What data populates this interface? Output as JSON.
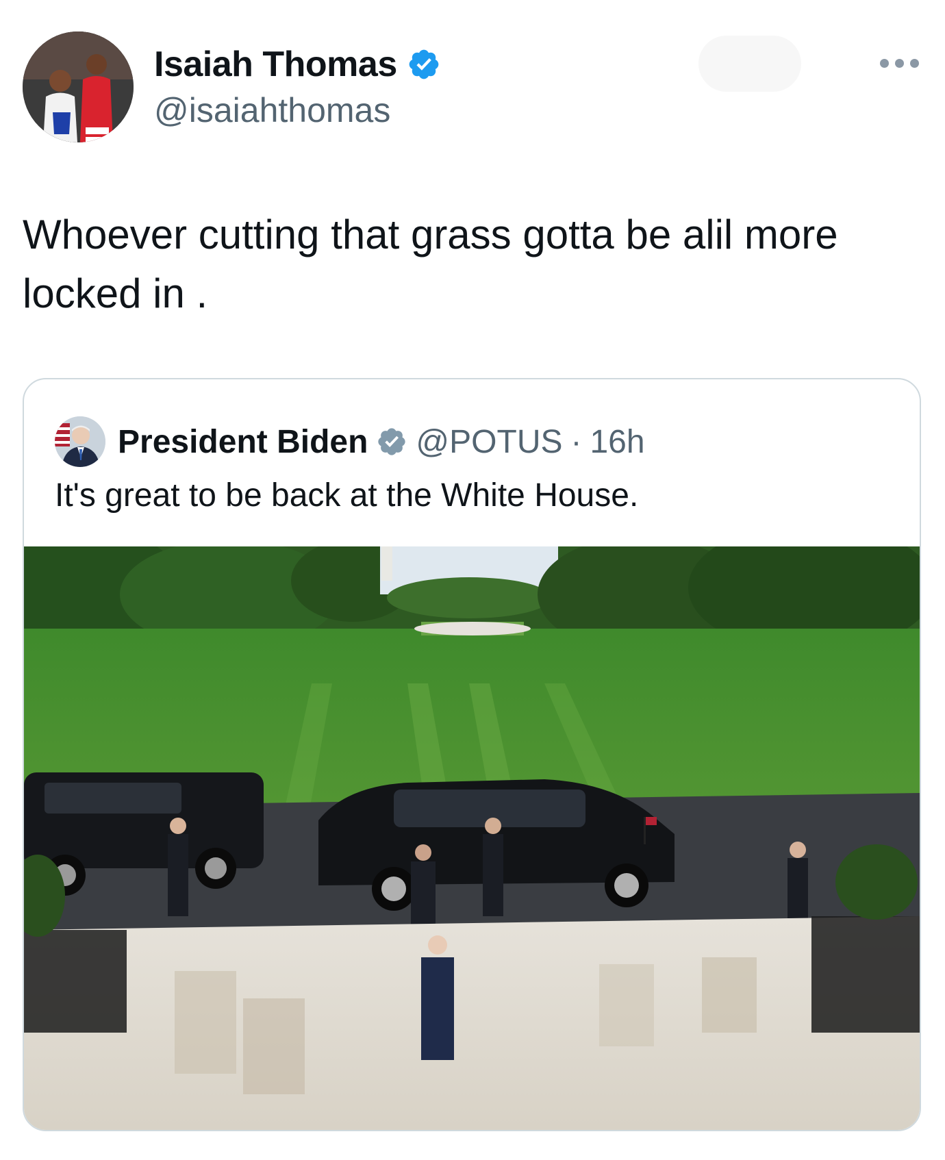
{
  "author": {
    "display_name": "Isaiah Thomas",
    "handle": "@isaiahthomas",
    "verified": true,
    "verified_color": "#1d9bf0"
  },
  "tweet": {
    "text": "Whoever cutting that grass gotta be alil more locked in ."
  },
  "quoted_tweet": {
    "display_name": "President Biden",
    "handle": "@POTUS",
    "separator": "·",
    "time": "16h",
    "verified": true,
    "verified_color": "#829aab",
    "text": "It's great to be back at the White House."
  },
  "icons": {
    "more": "more-horizontal-icon",
    "verified": "verified-badge-icon"
  }
}
